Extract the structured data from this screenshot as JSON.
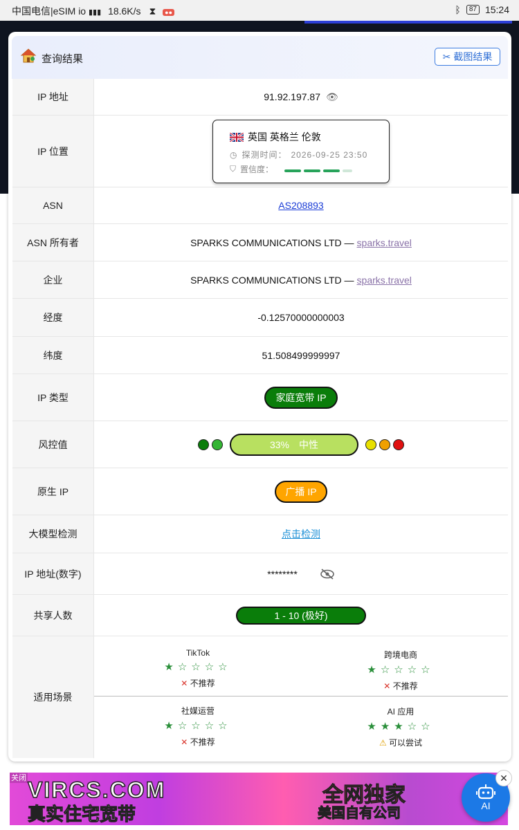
{
  "status_bar": {
    "carrier": "中国电信|eSIM io",
    "speed": "18.6K/s",
    "battery": "87",
    "time": "15:24"
  },
  "header": {
    "title": "查询结果",
    "screenshot_button": "截图结果"
  },
  "rows": {
    "ip_address": {
      "label": "IP 地址",
      "value": "91.92.197.87"
    },
    "ip_location": {
      "label": "IP 位置",
      "location": "英国 英格兰 伦敦",
      "probe_label": "探测时间：",
      "probe_time": "2026-09-25 23:50",
      "confidence_label": "置信度：",
      "confidence_level": 3,
      "confidence_max": 4
    },
    "asn": {
      "label": "ASN",
      "value": "AS208893"
    },
    "asn_owner": {
      "label": "ASN 所有者",
      "value": "SPARKS COMMUNICATIONS LTD —",
      "link": "sparks.travel"
    },
    "company": {
      "label": "企业",
      "value": "SPARKS COMMUNICATIONS LTD —",
      "link": "sparks.travel"
    },
    "longitude": {
      "label": "经度",
      "value": "-0.12570000000003"
    },
    "latitude": {
      "label": "纬度",
      "value": "51.508499999997"
    },
    "ip_type": {
      "label": "IP 类型",
      "value": "家庭宽带 IP",
      "color": "#0a7d0a"
    },
    "risk": {
      "label": "风控值",
      "percent_text": "33%",
      "level_text": "中性",
      "colors": [
        "#0a7d0a",
        "#33b533",
        "#b8e060",
        "#e8e000",
        "#f0a000",
        "#e01010"
      ]
    },
    "native_ip": {
      "label": "原生 IP",
      "value": "广播 IP",
      "color": "#ffa500"
    },
    "llm_check": {
      "label": "大模型检测",
      "value": "点击检测"
    },
    "ip_numeric": {
      "label": "IP 地址(数字)",
      "value": "********"
    },
    "shared_users": {
      "label": "共享人数",
      "value": "1 - 10 (极好)",
      "color": "#0a7d0a"
    },
    "scenarios": {
      "label": "适用场景",
      "items": [
        {
          "name": "TikTok",
          "rating": 1,
          "verdict": "不推荐"
        },
        {
          "name": "跨境电商",
          "rating": 1,
          "verdict": "不推荐"
        },
        {
          "name": "社媒运营",
          "rating": 1,
          "verdict": "不推荐"
        },
        {
          "name": "AI 应用",
          "rating": 3,
          "verdict": "可以尝试"
        }
      ]
    }
  },
  "ad": {
    "close_label": "关闭",
    "headline": "VIRCS.COM",
    "subline": "真实住宅宽带",
    "headline2": "全网独家",
    "subline2": "美国自有公司"
  },
  "ai_button": {
    "label": "AI"
  }
}
